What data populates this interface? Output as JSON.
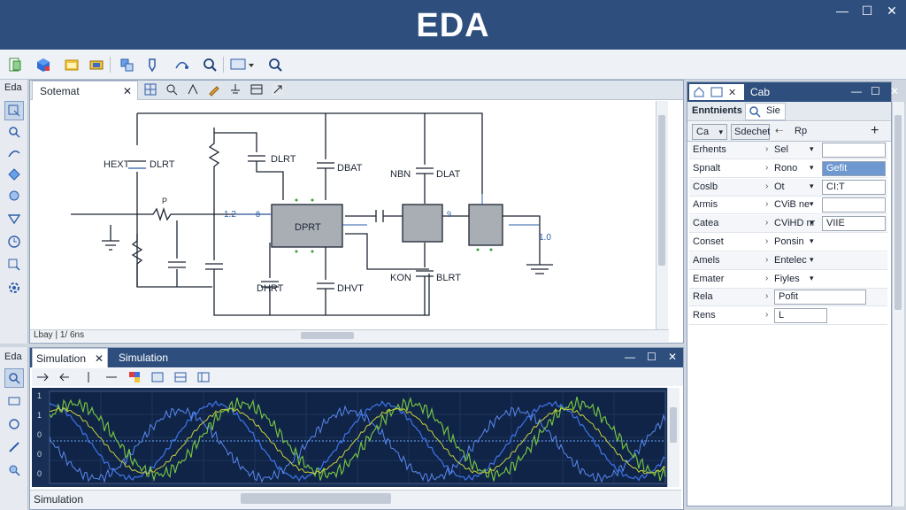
{
  "app": {
    "title": "EDA",
    "win_min": "—",
    "win_max": "☐",
    "win_close": "✕"
  },
  "toolbar": {
    "icons": [
      "new-file-icon",
      "cube-icon",
      "folder-icon",
      "component-icon",
      "library-icon",
      "probe-icon",
      "route-icon",
      "zoom-icon",
      "display-icon",
      "search-icon"
    ]
  },
  "schematic": {
    "side_label": "Eda",
    "tab_label": "Sotemat",
    "tab_close": "✕",
    "status_text": "Lbay | 1/ 6ns",
    "labels": {
      "hext": "HEXT",
      "dlrt1": "DLRT",
      "dlrt2": "DLRT",
      "dbat1": "DBAT",
      "nbn": "NBN",
      "dlat": "DLAT",
      "dprt": "DPRT",
      "dhrt": "DHRT",
      "dhvt": "DHVT",
      "kon": "KON",
      "blrt": "BLRT",
      "p": "P",
      "n12": "1.2",
      "n10": "1.0",
      "pin8": "8",
      "pin9": "9"
    }
  },
  "simulation": {
    "side_label": "Eda",
    "tab1": "Simulation",
    "tab1_close": "✕",
    "tab2": "Simulation",
    "status_text": "Simulation",
    "y_ticks": [
      "1",
      "1",
      "0",
      "0",
      "0"
    ],
    "win_min": "—",
    "win_max": "☐",
    "win_close": "✕"
  },
  "properties": {
    "tab_title": "Cab",
    "close": "✕",
    "sub_tab1": "Enntnients",
    "sub_tab2": "Sie",
    "header_col1": "Ca",
    "header_col2": "Sdechet",
    "header_col3": "Rp",
    "add": "+",
    "rows": [
      {
        "label": "Erhents",
        "value": "Sel",
        "box": ""
      },
      {
        "label": "Spnalt",
        "value": "Rono",
        "box": "Gefit"
      },
      {
        "label": "Coslb",
        "value": "Ot",
        "box": "CI:T"
      },
      {
        "label": "Armis",
        "value": "CViB ne",
        "box": ""
      },
      {
        "label": "Catea",
        "value": "CViHD nr",
        "box": "VIIE"
      },
      {
        "label": "Conset",
        "value": "Ponsin",
        "box": ""
      },
      {
        "label": "Amels",
        "value": "Entelec",
        "box": ""
      },
      {
        "label": "Emater",
        "value": "Fiyles",
        "box": ""
      },
      {
        "label": "Rela",
        "value": "",
        "box": "Pofit"
      },
      {
        "label": "Rens",
        "value": "",
        "box": "L"
      }
    ]
  },
  "colors": {
    "titlebar": "#2e4f7d",
    "scope_bg": "#0f2446",
    "trace_blue": "#3c6fe0",
    "trace_green": "#74c043",
    "trace_yellow": "#c8d23a",
    "ic_fill": "#a9aeb5",
    "selected_row": "#6e98d0"
  }
}
